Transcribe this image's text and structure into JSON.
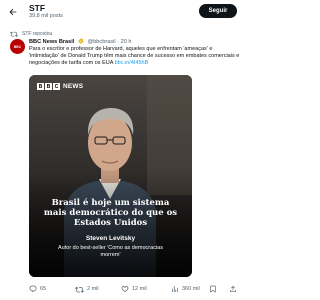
{
  "profile": {
    "name": "STF",
    "post_count": "39,8 mil posts",
    "follow_label": "Seguir"
  },
  "tweet": {
    "repost_label": "STF repostou",
    "avatar_text": "BBC",
    "author_name": "BBC News Brasil",
    "handle": "@bbcbrasil",
    "separator": "·",
    "time": "20 h",
    "text_main": "Para o escritor e professor de Harvard, aqueles que enfrentam 'ameaças' e 'intimidação' de Donald Trump têm mais chance de sucesso em embates comerciais e negociações de tarifa com os EUA",
    "link": "bbc.in/4I45hB"
  },
  "media": {
    "logo_letters": [
      "B",
      "B",
      "C"
    ],
    "logo_text": "NEWS",
    "headline": "Brasil é hoje um sistema mais democrático do que os Estados Unidos",
    "person_name": "Steven Levitsky",
    "person_desc": "Autor do best-seller 'Como as democracias morrem'"
  },
  "actions": {
    "replies": "65",
    "reposts": "2 mil",
    "likes": "12 mil",
    "views": "360 mil"
  },
  "colors": {
    "accent_link": "#1d9bf0",
    "bbc_red": "#b80000",
    "button_dark": "#0f1419"
  }
}
